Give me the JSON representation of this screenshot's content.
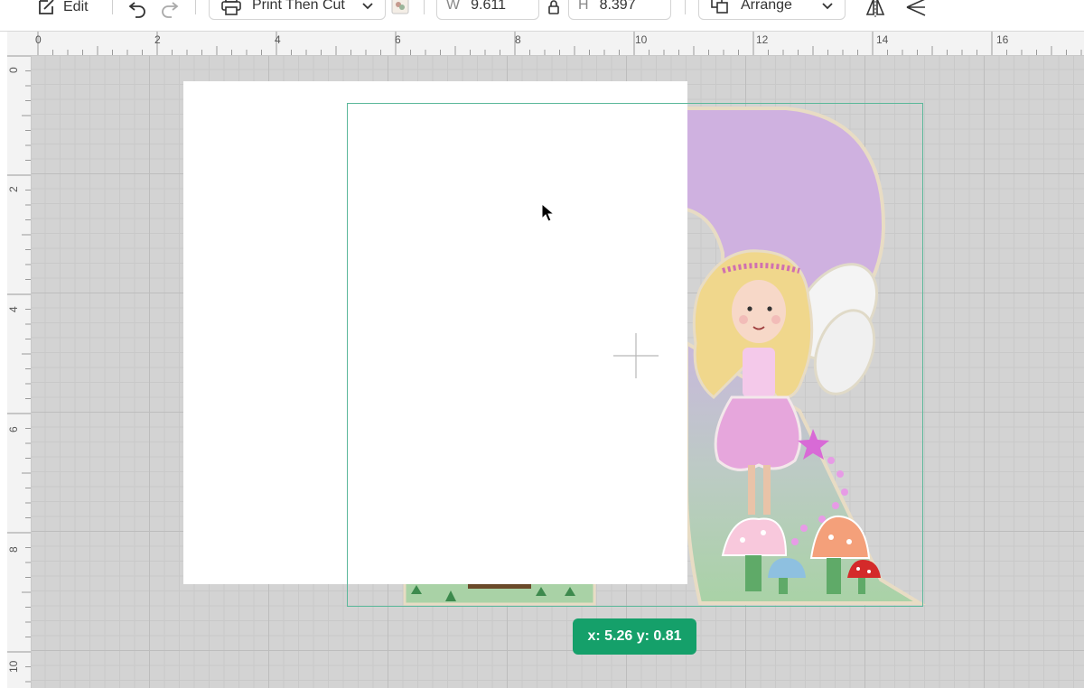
{
  "toolbar": {
    "edit_label": "Edit",
    "operation_label": "Print Then Cut",
    "width_label": "W",
    "width_value": "9.611",
    "height_label": "H",
    "height_value": "8.397",
    "arrange_label": "Arrange"
  },
  "ruler": {
    "top": [
      "0",
      "2",
      "4",
      "6",
      "8",
      "10",
      "12",
      "14",
      "16"
    ],
    "left": [
      "0",
      "2",
      "4",
      "6",
      "8",
      "10"
    ]
  },
  "canvas": {
    "coordinate_badge": "x: 5.26 y: 0.81"
  },
  "colors": {
    "accent": "#15a06a",
    "selection": "#5bb89a",
    "letter_purple": "#cfb1e0",
    "letter_green": "#b8d3b0"
  },
  "icons": [
    "edit-icon",
    "undo-icon",
    "redo-icon",
    "printer-icon",
    "chevron-down-icon",
    "color-swatch-icon",
    "lock-icon",
    "arrange-icon",
    "flip-icon",
    "align-icon",
    "cursor-icon",
    "crosshair-icon"
  ]
}
